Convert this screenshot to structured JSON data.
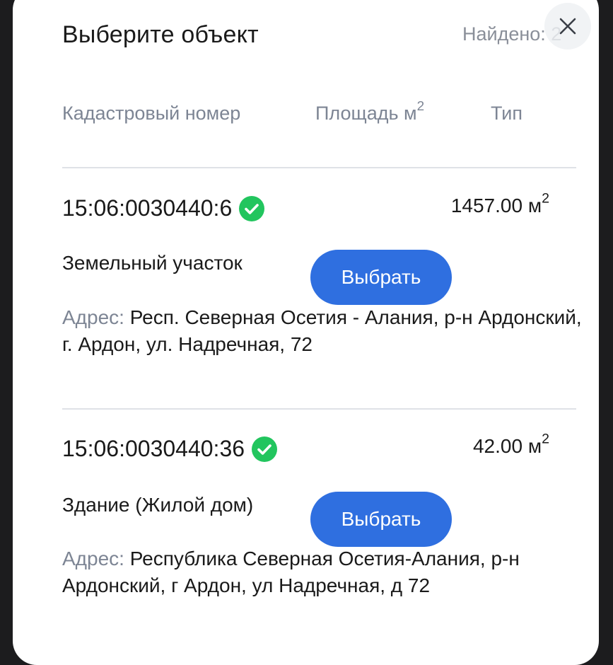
{
  "modal": {
    "title": "Выберите объект",
    "found_label": "Найдено: 2",
    "close_icon": "close-icon"
  },
  "columns": {
    "cadastral": "Кадастровый номер",
    "area": "Площадь м",
    "area_sup": "2",
    "type": "Тип"
  },
  "items": [
    {
      "cadastral_number": "15:06:0030440:6",
      "verified_icon": "check-circle-icon",
      "area": "1457.00 м",
      "area_sup": "2",
      "type": "Земельный участок",
      "select_label": "Выбрать",
      "address_label": "Адрес:",
      "address": "Респ. Северная Осетия - Алания, р-н Ардонский, г. Ардон, ул. Надречная, 72"
    },
    {
      "cadastral_number": "15:06:0030440:36",
      "verified_icon": "check-circle-icon",
      "area": "42.00 м",
      "area_sup": "2",
      "type": "Здание (Жилой дом)",
      "select_label": "Выбрать",
      "address_label": "Адрес:",
      "address": "Республика Северная Осетия-Алания, р-н Ардонский, г Ардон, ул Надречная, д 72"
    }
  ],
  "colors": {
    "accent": "#2f6fe0",
    "verified": "#22c55e",
    "muted_text": "#7d8594"
  }
}
